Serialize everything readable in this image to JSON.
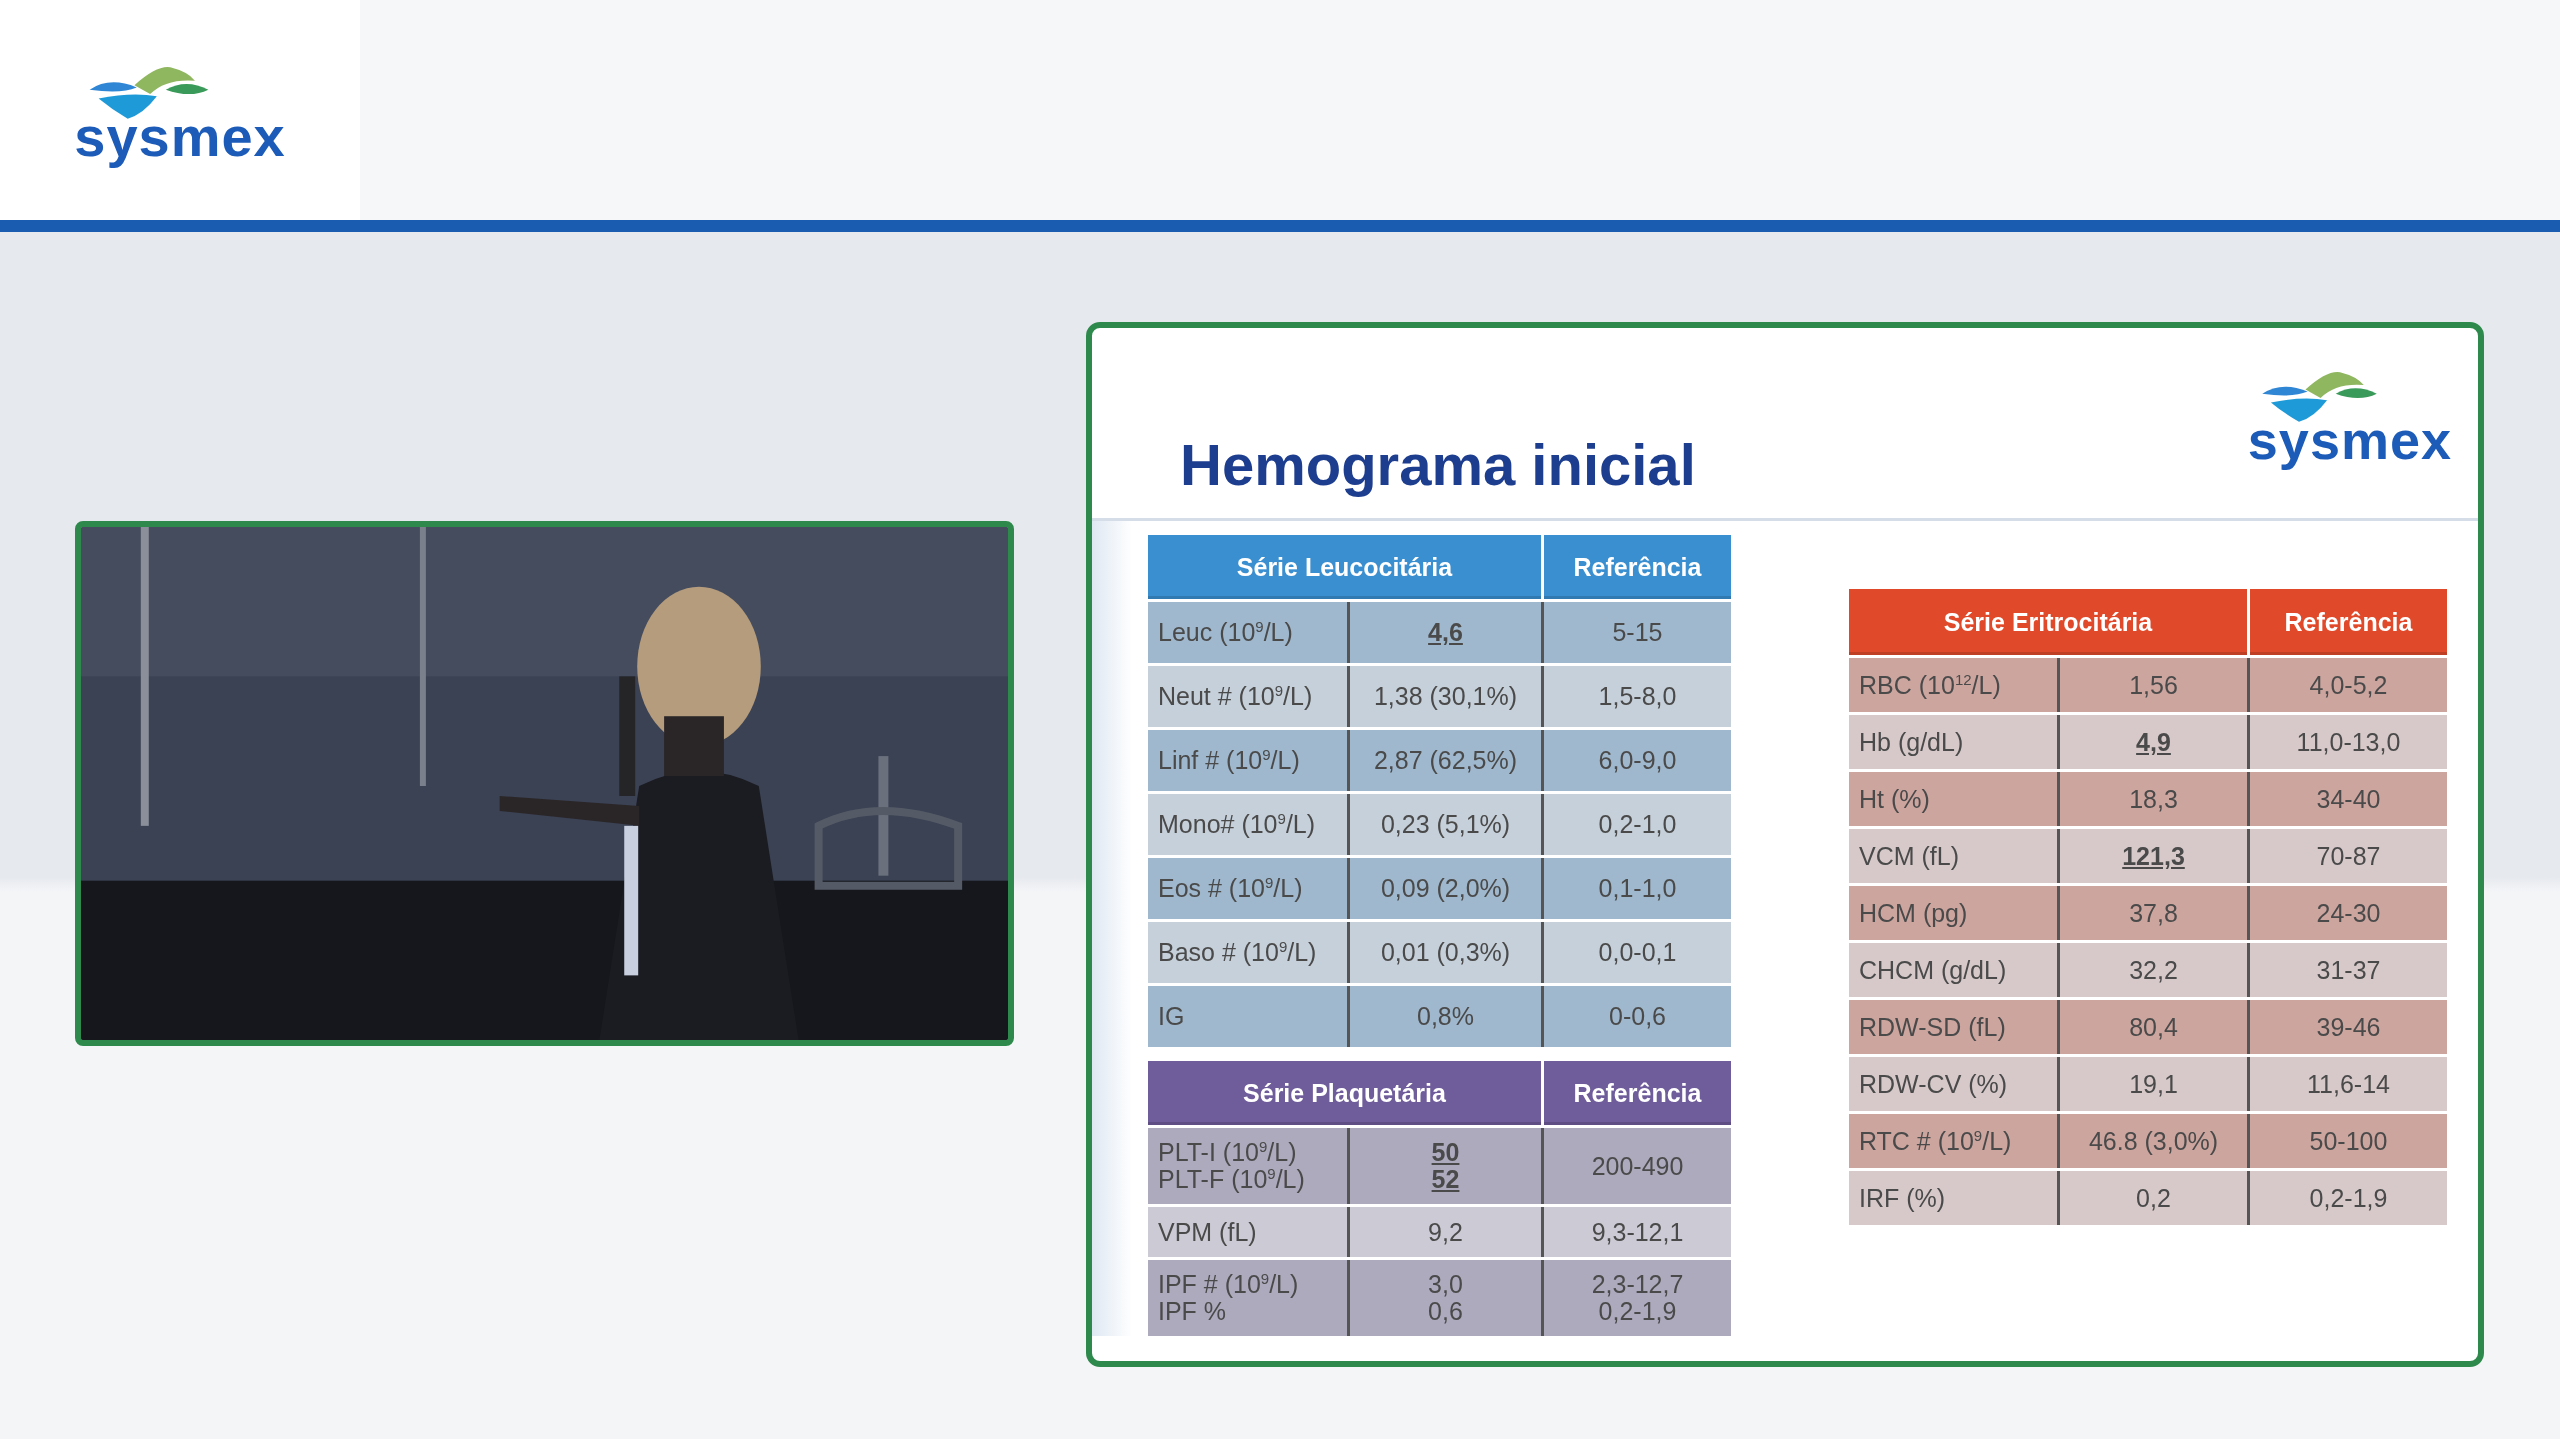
{
  "header": {
    "logo_text": "sysmex"
  },
  "slide": {
    "title": "Hemograma inicial",
    "logo_text": "sysmex",
    "left_tables": [
      {
        "color": "#3a8fd0",
        "columns": [
          "Série Leucocitária",
          "Referência"
        ],
        "rows": [
          {
            "parameter": [
              "Leuc (10$^{9}$/L)"
            ],
            "result": [
              {
                "text": "4,6",
                "emphasis": true
              }
            ],
            "reference": [
              "5-15"
            ]
          },
          {
            "parameter": [
              "Neut # (10$^{9}$/L)"
            ],
            "result": [
              {
                "text": "1,38 (30,1%)",
                "emphasis": false
              }
            ],
            "reference": [
              "1,5-8,0"
            ]
          },
          {
            "parameter": [
              "Linf # (10$^{9}$/L)"
            ],
            "result": [
              {
                "text": "2,87 (62,5%)",
                "emphasis": false
              }
            ],
            "reference": [
              "6,0-9,0"
            ]
          },
          {
            "parameter": [
              "Mono# (10$^{9}$/L)"
            ],
            "result": [
              {
                "text": "0,23 (5,1%)",
                "emphasis": false
              }
            ],
            "reference": [
              "0,2-1,0"
            ]
          },
          {
            "parameter": [
              "Eos # (10$^{9}$/L)"
            ],
            "result": [
              {
                "text": "0,09 (2,0%)",
                "emphasis": false
              }
            ],
            "reference": [
              "0,1-1,0"
            ]
          },
          {
            "parameter": [
              "Baso # (10$^{9}$/L)"
            ],
            "result": [
              {
                "text": "0,01 (0,3%)",
                "emphasis": false
              }
            ],
            "reference": [
              "0,0-0,1"
            ]
          },
          {
            "parameter": [
              "IG"
            ],
            "result": [
              {
                "text": "0,8%",
                "emphasis": false
              }
            ],
            "reference": [
              "0-0,6"
            ]
          }
        ]
      },
      {
        "color": "#6f5c9a",
        "columns": [
          "Série Plaquetária",
          "Referência"
        ],
        "rows": [
          {
            "parameter": [
              "PLT-I (10$^{9}$/L)",
              "PLT-F (10$^{9}$/L)"
            ],
            "result": [
              {
                "text": "50",
                "emphasis": true
              },
              {
                "text": "52",
                "emphasis": true
              }
            ],
            "reference": [
              "200-490"
            ]
          },
          {
            "parameter": [
              "VPM (fL)"
            ],
            "result": [
              {
                "text": "9,2",
                "emphasis": false
              }
            ],
            "reference": [
              "9,3-12,1"
            ]
          },
          {
            "parameter": [
              "IPF # (10$^{9}$/L)",
              "IPF %"
            ],
            "result": [
              {
                "text": "3,0",
                "emphasis": false
              },
              {
                "text": "0,6",
                "emphasis": false
              }
            ],
            "reference": [
              "2,3-12,7",
              "0,2-1,9"
            ]
          }
        ]
      }
    ],
    "right_tables": [
      {
        "color": "#e04a2a",
        "columns": [
          "Série Eritrocitária",
          "Referência"
        ],
        "rows": [
          {
            "parameter": [
              "RBC (10$^{12}$/L)"
            ],
            "result": [
              {
                "text": "1,56",
                "emphasis": false
              }
            ],
            "reference": [
              "4,0-5,2"
            ]
          },
          {
            "parameter": [
              "Hb (g/dL)"
            ],
            "result": [
              {
                "text": "4,9",
                "emphasis": true
              }
            ],
            "reference": [
              "11,0-13,0"
            ]
          },
          {
            "parameter": [
              "Ht (%)"
            ],
            "result": [
              {
                "text": "18,3",
                "emphasis": false
              }
            ],
            "reference": [
              "34-40"
            ]
          },
          {
            "parameter": [
              "VCM (fL)"
            ],
            "result": [
              {
                "text": "121,3",
                "emphasis": true
              }
            ],
            "reference": [
              "70-87"
            ]
          },
          {
            "parameter": [
              "HCM (pg)"
            ],
            "result": [
              {
                "text": "37,8",
                "emphasis": false
              }
            ],
            "reference": [
              "24-30"
            ]
          },
          {
            "parameter": [
              "CHCM (g/dL)"
            ],
            "result": [
              {
                "text": "32,2",
                "emphasis": false
              }
            ],
            "reference": [
              "31-37"
            ]
          },
          {
            "parameter": [
              "RDW-SD (fL)"
            ],
            "result": [
              {
                "text": "80,4",
                "emphasis": false
              }
            ],
            "reference": [
              "39-46"
            ]
          },
          {
            "parameter": [
              "RDW-CV (%)"
            ],
            "result": [
              {
                "text": "19,1",
                "emphasis": false
              }
            ],
            "reference": [
              "11,6-14"
            ]
          },
          {
            "parameter": [
              "RTC # (10$^{9}$/L)"
            ],
            "result": [
              {
                "text": "46.8 (3,0%)",
                "emphasis": false
              }
            ],
            "reference": [
              "50-100"
            ]
          },
          {
            "parameter": [
              "IRF (%)"
            ],
            "result": [
              {
                "text": "0,2",
                "emphasis": false
              }
            ],
            "reference": [
              "0,2-1,9"
            ]
          }
        ]
      }
    ]
  }
}
